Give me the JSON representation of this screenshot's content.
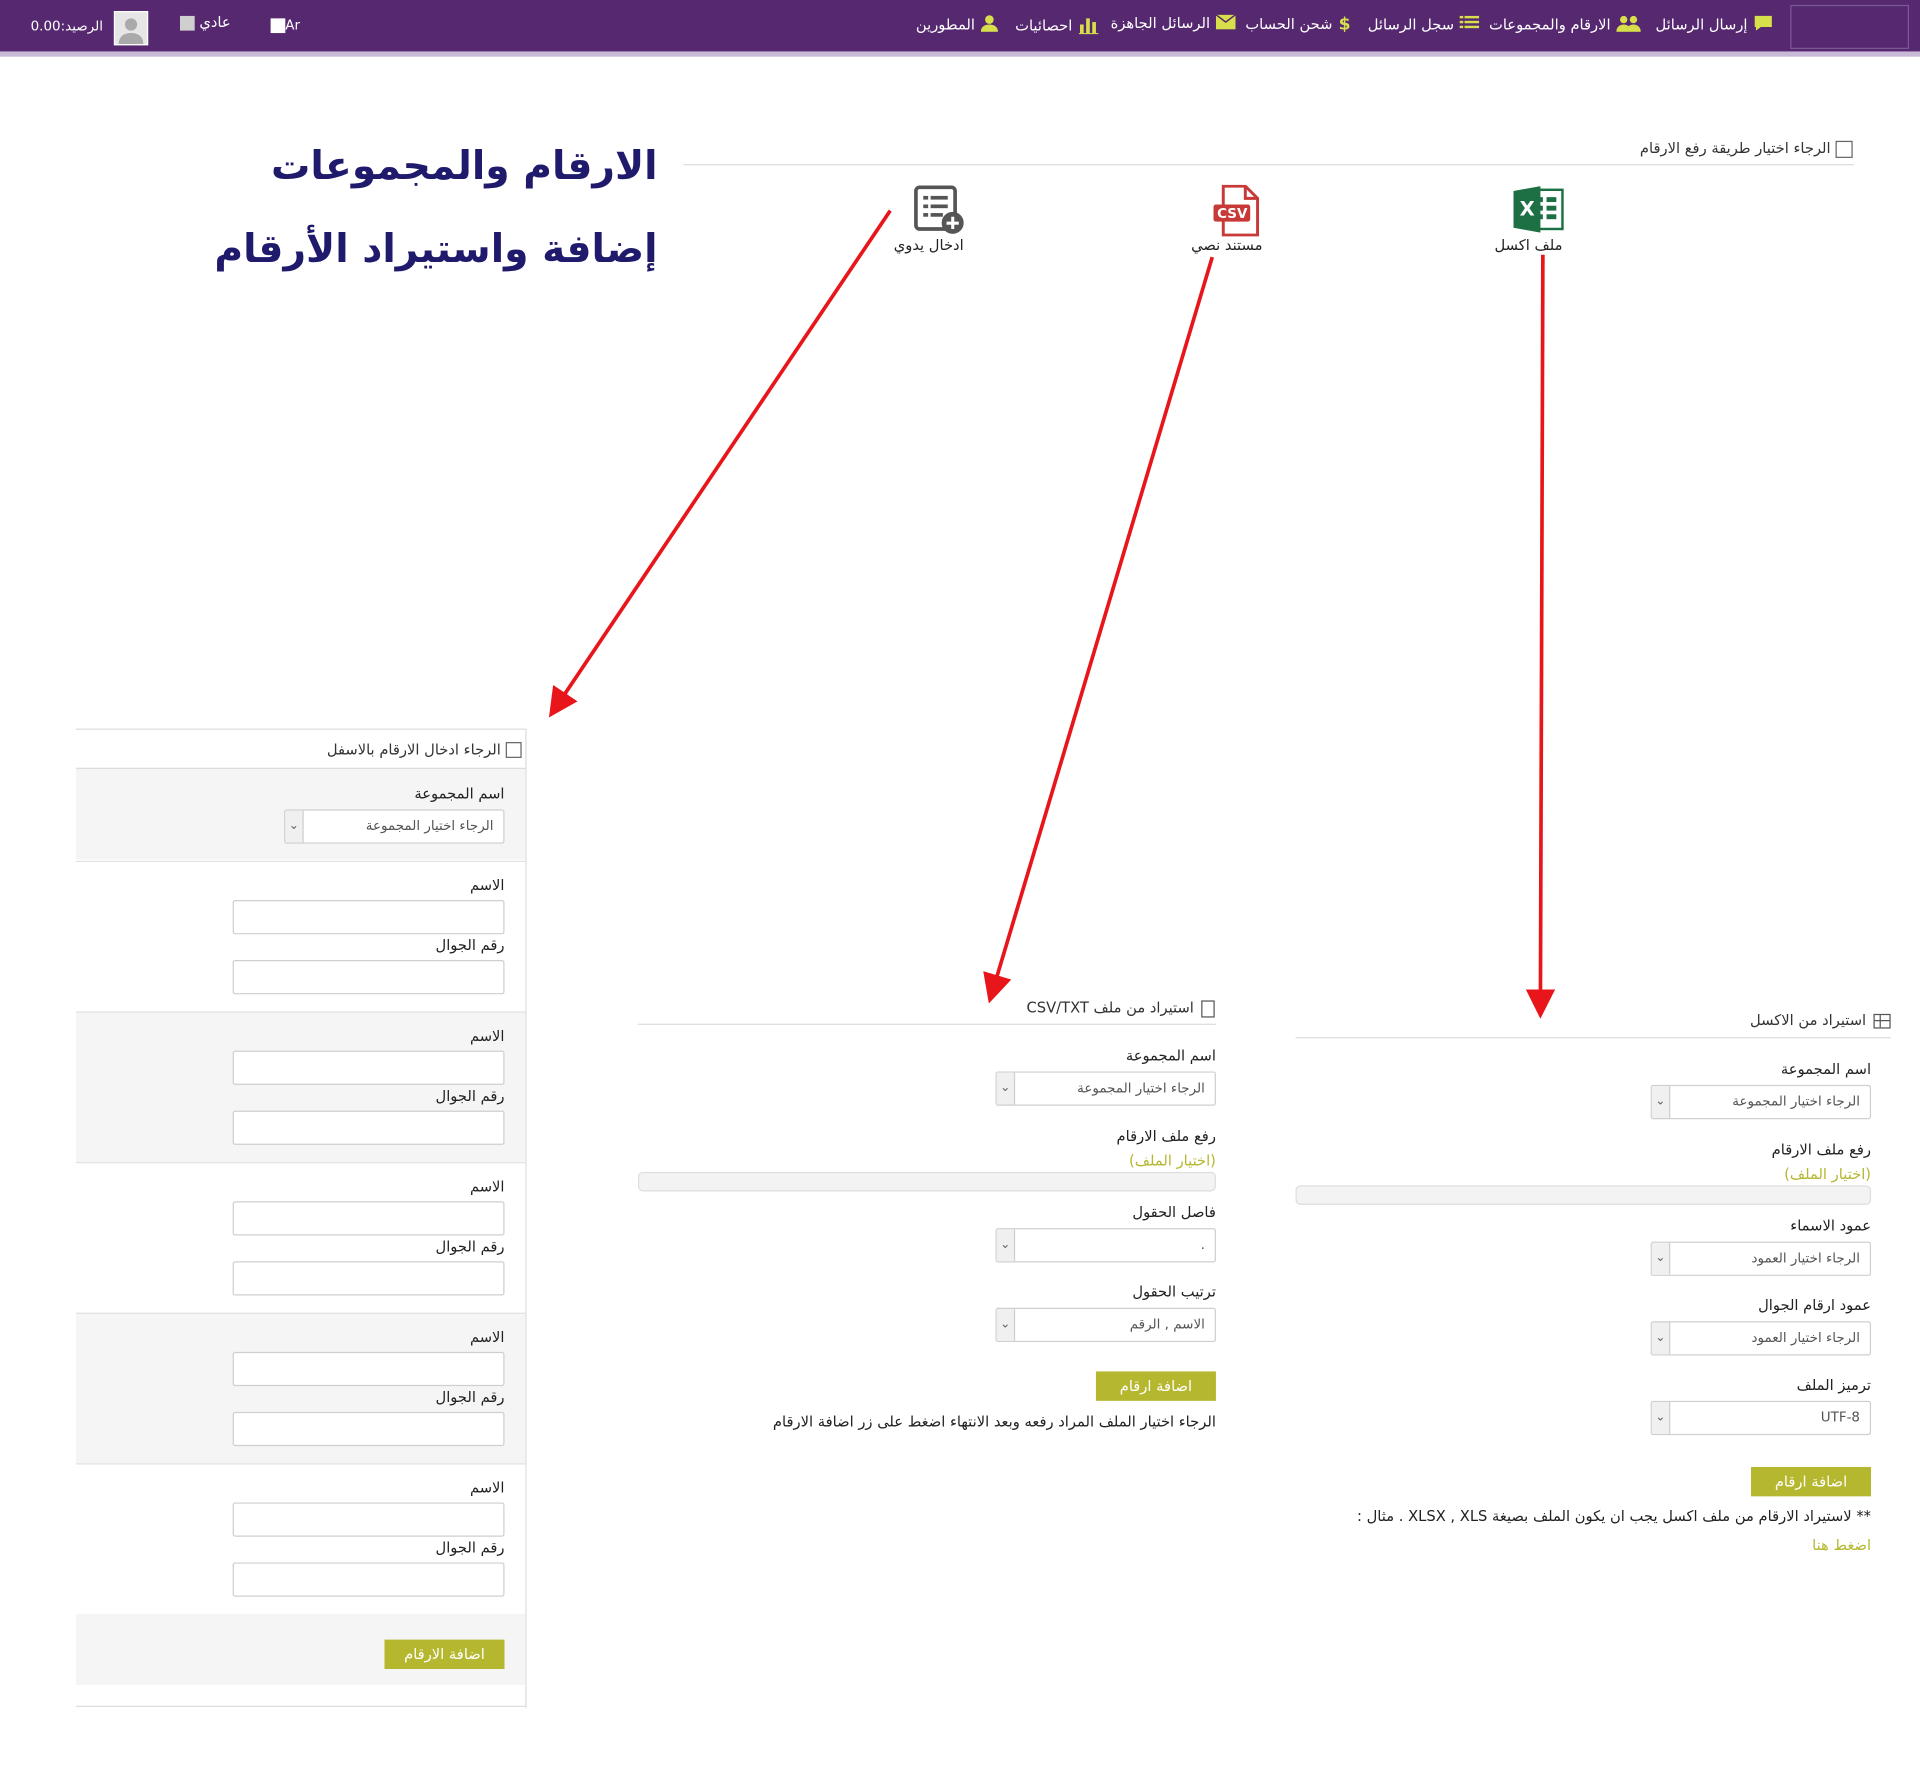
{
  "nav": {
    "items": [
      {
        "label": "إرسال الرسائل",
        "icon": "chat-bubble-icon"
      },
      {
        "label": "الارقام والمجموعات",
        "icon": "users-group-icon"
      },
      {
        "label": "سجل الرسائل",
        "icon": "list-icon"
      },
      {
        "label": "شحن الحساب",
        "icon": "dollar-icon"
      },
      {
        "label": "الرسائل الجاهزة",
        "icon": "envelope-icon"
      },
      {
        "label": "احصائيات",
        "icon": "bar-chart-icon"
      },
      {
        "label": "المطورين",
        "icon": "user-icon"
      }
    ],
    "lang": "Ar",
    "mode": "عادي",
    "balance_label": "الرصيد:",
    "balance_value": "0.00"
  },
  "titles": {
    "main": "الارقام والمجموعات",
    "sub": "إضافة واستيراد الأرقام"
  },
  "upload_method": {
    "heading": "الرجاء اختيار طريقة رفع الارقام",
    "options": [
      {
        "label": "ملف اكسل",
        "icon": "excel-file-icon"
      },
      {
        "label": "مستند نصي",
        "icon": "csv-file-icon"
      },
      {
        "label": "ادخال يدوي",
        "icon": "manual-list-add-icon"
      }
    ]
  },
  "manual": {
    "heading": "الرجاء ادخال الارقام بالاسفل",
    "group_label": "اسم المجموعة",
    "group_placeholder": "الرجاء اختيار المجموعة",
    "name_label": "الاسم",
    "mobile_label": "رقم الجوال",
    "submit": "اضافة الارقام"
  },
  "csv": {
    "heading": "استيراد من ملف CSV/TXT",
    "group_label": "اسم المجموعة",
    "group_placeholder": "الرجاء اختيار المجموعة",
    "file_label": "رفع ملف الارقام",
    "choose_file": "(اختيار الملف)",
    "separator_label": "فاصل الحقول",
    "separator_value": ".",
    "order_label": "ترتيب الحقول",
    "order_value": "الاسم , الرقم",
    "submit": "اضافة ارقام",
    "note": "الرجاء اختيار الملف المراد رفعه وبعد الانتهاء اضغط على زر اضافة الارقام"
  },
  "excel": {
    "heading": "استيراد من الاكسل",
    "group_label": "اسم المجموعة",
    "group_placeholder": "الرجاء اختيار المجموعة",
    "file_label": "رفع ملف الارقام",
    "choose_file": "(اختيار الملف)",
    "names_col_label": "عمود الاسماء",
    "names_col_placeholder": "الرجاء اختيار العمود",
    "mobile_col_label": "عمود ارقام الجوال",
    "mobile_col_placeholder": "الرجاء اختيار العمود",
    "encoding_label": "ترميز الملف",
    "encoding_value": "UTF-8",
    "submit": "اضافة ارقام",
    "note": "** لاستيراد الارقام من ملف اكسل يجب ان يكون الملف بصيغة XLSX , XLS . مثال :",
    "example_link": "اضغط هنا"
  },
  "colors": {
    "nav_bg": "#55286f",
    "accent": "#b5b72e",
    "title": "#1f1a6b",
    "arrow": "#e8161b"
  }
}
